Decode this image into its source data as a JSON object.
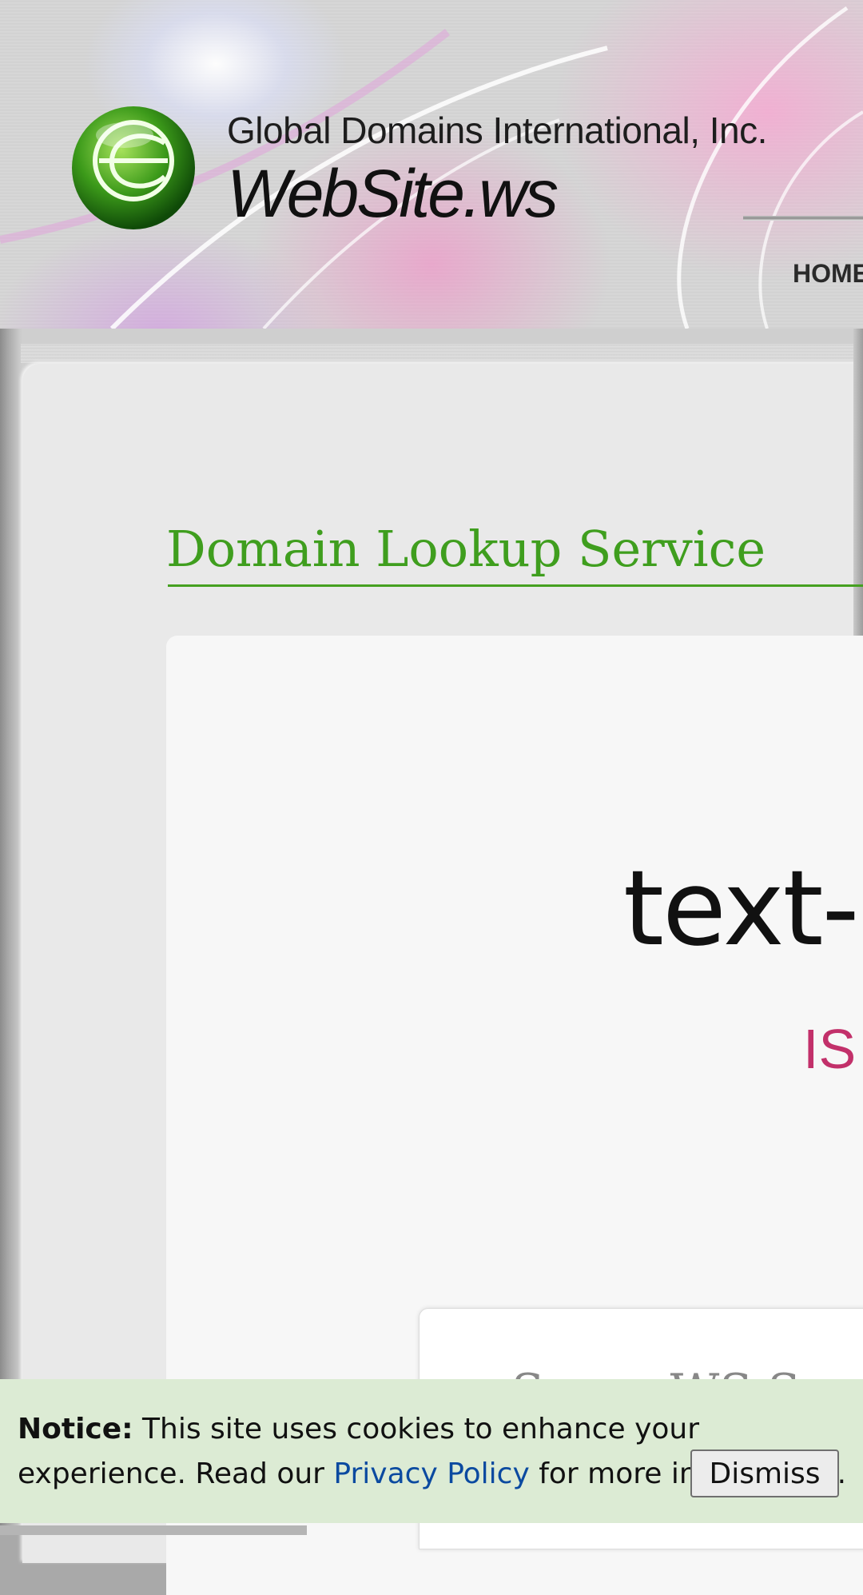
{
  "header": {
    "company_name": "Global Domains International, Inc.",
    "brand_name": "WebSite.ws",
    "nav_home": "HOME",
    "logo_icon": "globe-logo-icon"
  },
  "main": {
    "section_title": "Domain Lookup Service",
    "domain_text": "text-",
    "status_text": "IS",
    "result_heading": "Sorry, WS Sa"
  },
  "cookie_notice": {
    "label": "Notice:",
    "message_before_link": " This site uses cookies to enhance your experience. Read our ",
    "link_text": "Privacy Policy",
    "message_after_link": " for more information.",
    "dismiss_label": "Dismiss"
  },
  "colors": {
    "accent_green": "#3f9e1e",
    "status_pink": "#c2306a",
    "link_blue": "#0b4aa0",
    "notice_bg": "#dcebd4"
  }
}
